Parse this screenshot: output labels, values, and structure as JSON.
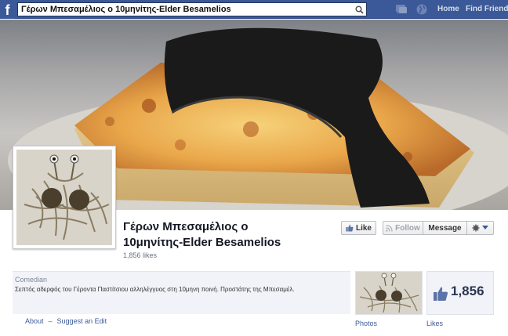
{
  "topbar": {
    "logo": "f",
    "search_value": "Γέρων Μπεσαμέλιος ο 10μηνίτης-Elder Besamelios",
    "nav": [
      "Home",
      "Find Friends"
    ]
  },
  "page": {
    "name_line1": "Γέρων Μπεσαμέλιος ο",
    "name_line2": "10μηνίτης-Elder Besamelios",
    "likes_text": "1,856 likes"
  },
  "actions": {
    "like": "Like",
    "follow": "Follow",
    "message": "Message"
  },
  "about": {
    "category": "Comedian",
    "description": "Σεπτός αδερφός του Γέροντα Παστίτσιου αλληλέγγυος στη 10μηνη ποινή. Προστάτης της Μπεσαμέλ.",
    "links": [
      "About",
      "Suggest an Edit"
    ]
  },
  "apps": {
    "photos_label": "Photos",
    "likes_label": "Likes",
    "likes_number": "1,856"
  },
  "colors": {
    "facebook_blue": "#3b5998",
    "link_blue": "#3b5998"
  },
  "icons": [
    "search-icon",
    "friend-requests-icon",
    "globe-icon",
    "thumbs-up-icon",
    "rss-icon",
    "gear-icon",
    "chevron-down-icon"
  ]
}
